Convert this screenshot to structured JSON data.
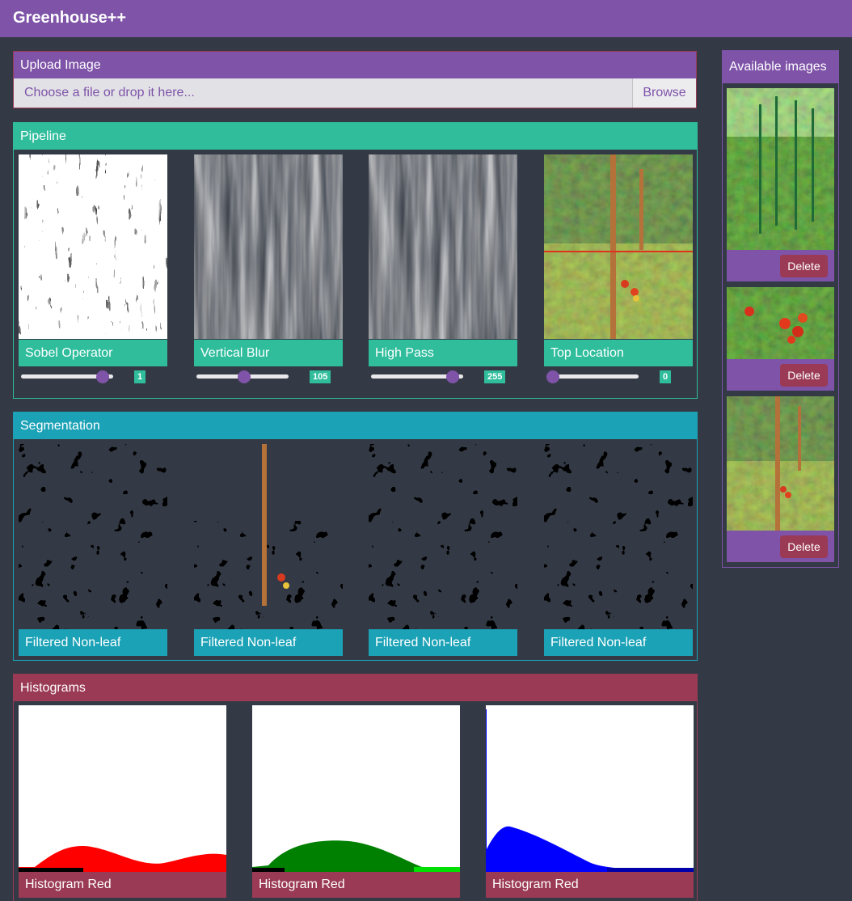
{
  "app": {
    "title": "Greenhouse++"
  },
  "upload": {
    "header": "Upload Image",
    "placeholder": "Choose a file or drop it here...",
    "browse_label": "Browse"
  },
  "pipeline": {
    "header": "Pipeline",
    "steps": [
      {
        "label": "Sobel Operator",
        "value": "1",
        "slider_fraction": 0.95
      },
      {
        "label": "Vertical Blur",
        "value": "105",
        "slider_fraction": 0.52
      },
      {
        "label": "High Pass",
        "value": "255",
        "slider_fraction": 0.95
      },
      {
        "label": "Top Location",
        "value": "0",
        "slider_fraction": 0.0
      }
    ]
  },
  "segmentation": {
    "header": "Segmentation",
    "items": [
      {
        "label": "Filtered Non-leaf"
      },
      {
        "label": "Filtered Non-leaf"
      },
      {
        "label": "Filtered Non-leaf"
      },
      {
        "label": "Filtered Non-leaf"
      }
    ]
  },
  "histograms": {
    "header": "Histograms",
    "items": [
      {
        "label": "Histogram Red",
        "color": "#ff0000"
      },
      {
        "label": "Histogram Red",
        "color": "#008000"
      },
      {
        "label": "Histogram Red",
        "color": "#0000ff"
      }
    ]
  },
  "sidebar": {
    "header": "Available images",
    "images": [
      {
        "delete_label": "Delete"
      },
      {
        "delete_label": "Delete"
      },
      {
        "delete_label": "Delete"
      }
    ]
  },
  "colors": {
    "purple": "#7e53a8",
    "teal": "#2fbd9c",
    "cyan": "#1ba2b6",
    "crimson": "#9a3a55",
    "background": "#343a45"
  }
}
